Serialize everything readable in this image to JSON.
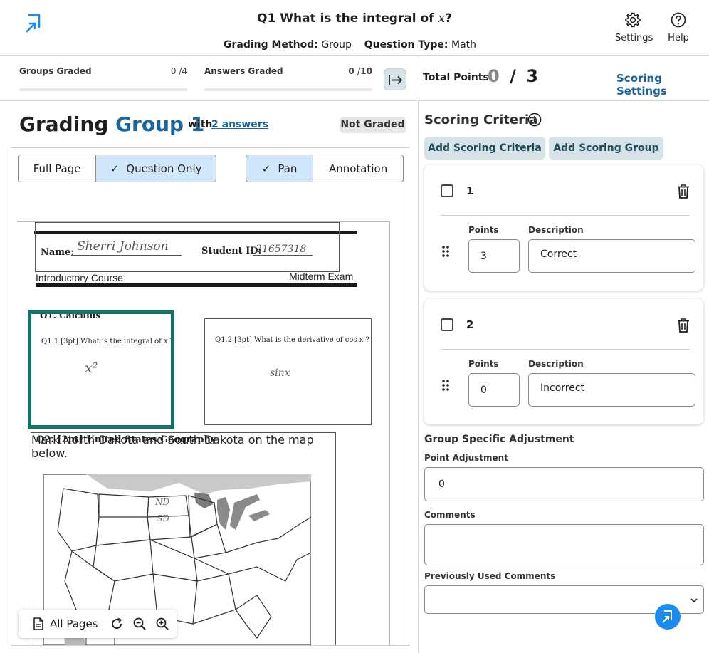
{
  "header": {
    "question_title_prefix": "Q1 What is the integral of ",
    "question_var": "x",
    "question_title_suffix": "?",
    "grading_method_label": "Grading Method:",
    "grading_method_value": "Group",
    "question_type_label": "Question Type:",
    "question_type_value": "Math",
    "settings_label": "Settings",
    "help_label": "Help"
  },
  "stats": {
    "groups_label": "Groups Graded",
    "groups_value": "0 /4",
    "groups_progress": 0,
    "answers_label": "Answers Graded",
    "answers_value": "0 /10",
    "answers_progress": 0
  },
  "total_points": {
    "label": "Total Points:",
    "earned": "0",
    "separator": "/",
    "possible": "3",
    "scoring_settings_link": "Scoring Settings"
  },
  "group": {
    "title_prefix": "Grading",
    "title_group": "Group 1",
    "with_label": "with",
    "answers_link": "2 answers",
    "status_badge": "Not Graded"
  },
  "viewer": {
    "view_toggle": [
      {
        "label": "Full Page",
        "selected": false
      },
      {
        "label": "Question Only",
        "selected": true
      }
    ],
    "mode_toggle": [
      {
        "label": "Pan",
        "selected": true
      },
      {
        "label": "Annotation",
        "selected": false
      }
    ],
    "check_glyph": "✓",
    "pager_label": "All Pages"
  },
  "paper": {
    "name_label": "Name:",
    "name_value": "Sherri Johnson",
    "student_id_label": "Student ID:",
    "student_id_value": "21657318",
    "course": "Introductory Course",
    "exam": "Midterm Exam",
    "q1_heading": "Q1. Calculus",
    "q11_text": "Q1.1 [3pt] What is the integral of x ?",
    "q11_answer": "x²",
    "q12_text": "Q1.2 [3pt] What is the derivative of cos x ?",
    "q12_answer": "sinx",
    "q2_heading": "Q2. [2pt] United States Geography",
    "q2_text": "Mark North Dakota and South Dakota on the map below.",
    "map_nd": "ND",
    "map_sd": "SD"
  },
  "scoring": {
    "title": "Scoring Criteria",
    "add_criteria": "Add Scoring Criteria",
    "add_group": "Add Scoring Group",
    "points_label": "Points",
    "description_label": "Description",
    "criteria": [
      {
        "number": "1",
        "points": "3",
        "description": "Correct"
      },
      {
        "number": "2",
        "points": "0",
        "description": "Incorrect"
      }
    ],
    "adjustment_heading": "Group Specific Adjustment",
    "point_adjustment_label": "Point Adjustment",
    "point_adjustment_value": "0",
    "comments_label": "Comments",
    "comments_value": "",
    "previous_comments_label": "Previously Used Comments",
    "previous_comments_selected": ""
  },
  "colors": {
    "accent": "#1a64a0",
    "selection": "#107468",
    "toggle_on": "#cfe6fb",
    "teal_button": "#d5e3e6",
    "fab": "#1a8cf0"
  }
}
